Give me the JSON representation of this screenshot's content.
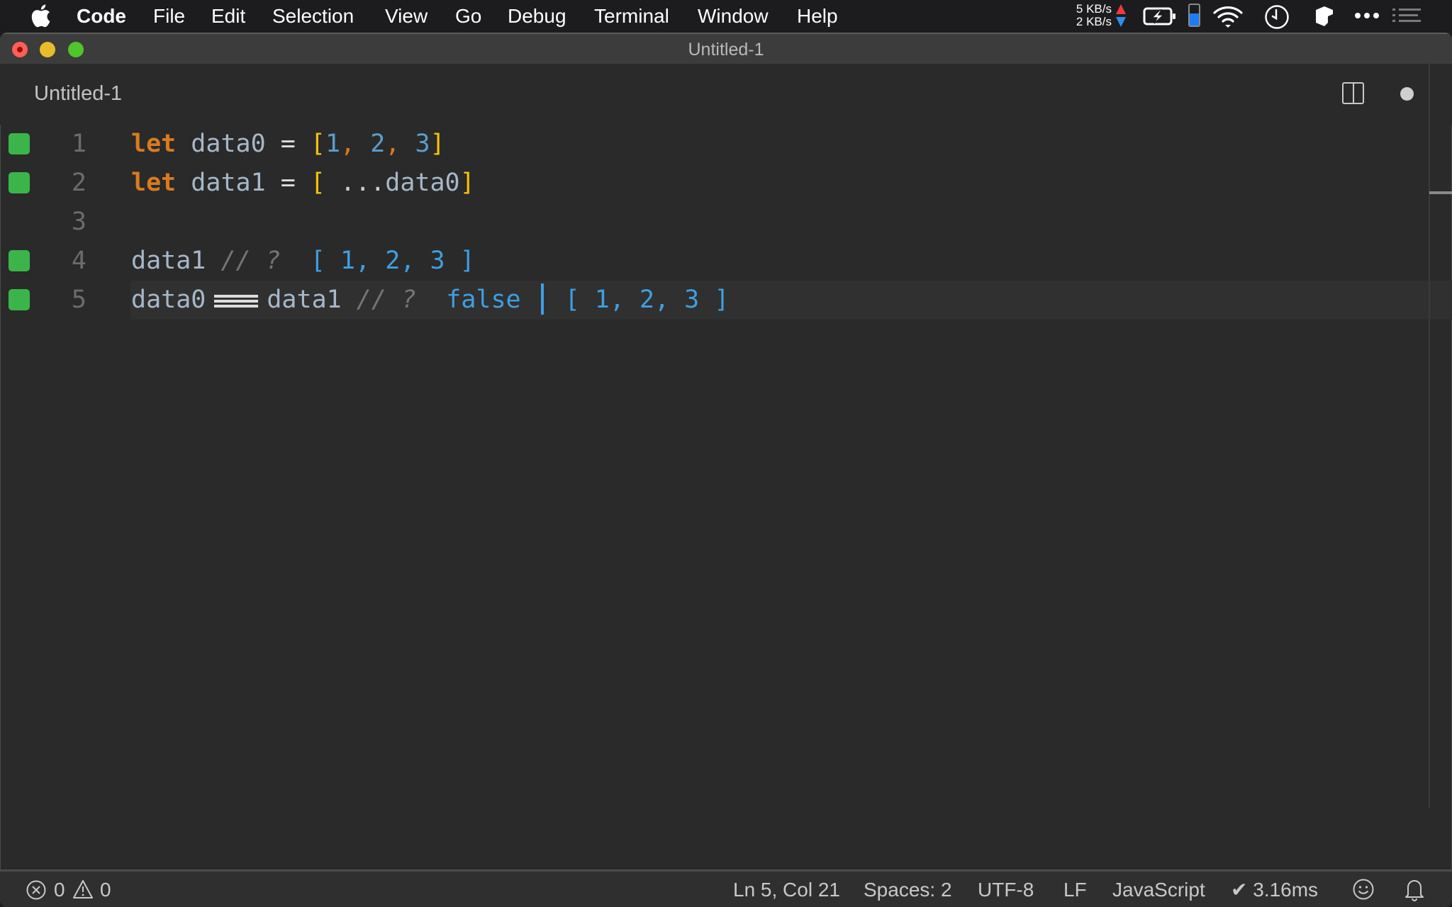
{
  "menubar": {
    "app_name": "Code",
    "items": [
      "File",
      "Edit",
      "Selection",
      "View",
      "Go",
      "Debug",
      "Terminal",
      "Window",
      "Help"
    ],
    "tray": {
      "upload_speed": "5 KB/s",
      "download_speed": "2 KB/s",
      "battery_state": "charging",
      "level_gauge_fraction": 0.6,
      "icons": [
        "apple-logo-icon",
        "network-speed-icon",
        "battery-charging-icon",
        "level-gauge-icon",
        "wifi-icon",
        "clock-icon",
        "box-app-icon",
        "more-dots-icon",
        "notification-list-icon"
      ]
    }
  },
  "window": {
    "title": "Untitled-1",
    "tab": {
      "label": "Untitled-1",
      "dirty": true
    }
  },
  "editor": {
    "language": "JavaScript",
    "current_line": 5,
    "lines": [
      {
        "number": "1",
        "marker": true,
        "tokens": {
          "kw": "let",
          "name": "data0",
          "eq": "=",
          "open": "[",
          "n1": "1",
          "c1": ",",
          "n2": "2",
          "c2": ",",
          "n3": "3",
          "close": "]"
        }
      },
      {
        "number": "2",
        "marker": true,
        "tokens": {
          "kw": "let",
          "name": "data1",
          "eq": "=",
          "open": "[",
          "spread": "...",
          "ref": "data0",
          "close": "]"
        }
      },
      {
        "number": "3",
        "marker": false
      },
      {
        "number": "4",
        "marker": true,
        "tokens": {
          "expr": "data1",
          "comment": "// ?",
          "result": "[ 1, 2, 3 ]"
        }
      },
      {
        "number": "5",
        "marker": true,
        "tokens": {
          "left": "data0",
          "right": "data1",
          "comment": "// ?",
          "result1": "false",
          "result2": "[ 1, 2, 3 ]"
        }
      }
    ],
    "marker_color": "#3bb54a"
  },
  "statusbar": {
    "errors": "0",
    "warnings": "0",
    "position": "Ln 5, Col 21",
    "indent": "Spaces: 2",
    "encoding": "UTF-8",
    "eol": "LF",
    "language": "JavaScript",
    "timing": "✔ 3.16ms"
  }
}
